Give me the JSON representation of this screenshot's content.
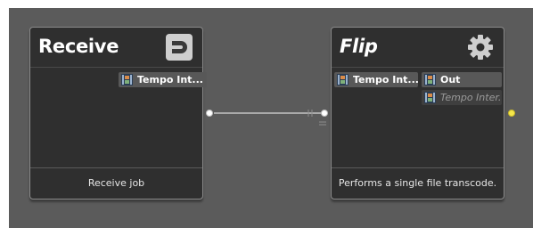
{
  "nodes": {
    "receive": {
      "title": "Receive",
      "icon": "receive-icon",
      "input_pill": "Tempo Int...",
      "description": "Receive job"
    },
    "flip": {
      "title": "Flip",
      "icon": "gear-icon",
      "input_pill": "Tempo Int...",
      "output_pill": "Out",
      "output_pill_secondary": "Tempo Inter...",
      "description": "Performs a single file transcode."
    }
  },
  "colors": {
    "canvas": "#5b5b5b",
    "node_body": "#2f2f2f",
    "pill": "#585858",
    "port_white": "#ffffff",
    "port_yellow": "#f4e64a",
    "connector": "#d9d9d9"
  }
}
